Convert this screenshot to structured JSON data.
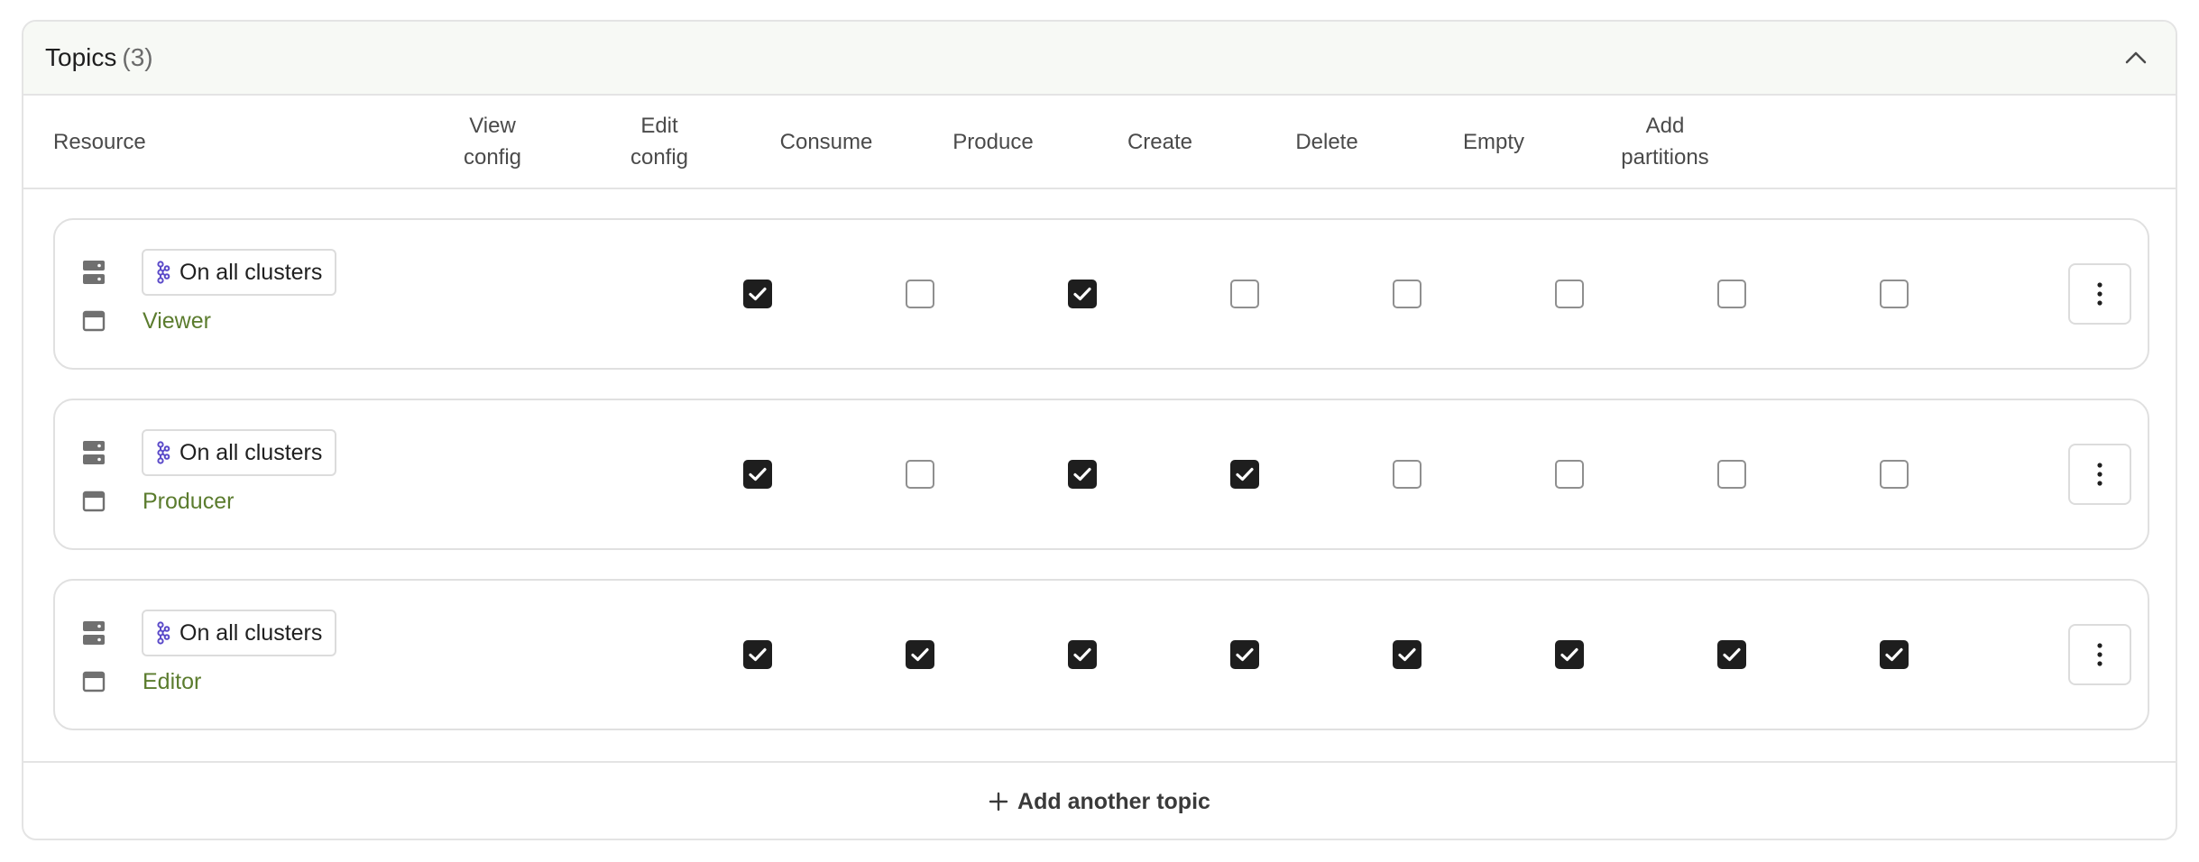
{
  "section": {
    "title": "Topics",
    "count": "(3)"
  },
  "columns": {
    "resource": "Resource",
    "view_config": [
      "View",
      "config"
    ],
    "edit_config": [
      "Edit",
      "config"
    ],
    "consume": "Consume",
    "produce": "Produce",
    "create": "Create",
    "delete": "Delete",
    "empty": "Empty",
    "add_partitions": [
      "Add",
      "partitions"
    ]
  },
  "rows": [
    {
      "cluster": "On all clusters",
      "name": "Viewer",
      "perms": [
        true,
        false,
        true,
        false,
        false,
        false,
        false,
        false
      ]
    },
    {
      "cluster": "On all clusters",
      "name": "Producer",
      "perms": [
        true,
        false,
        true,
        true,
        false,
        false,
        false,
        false
      ]
    },
    {
      "cluster": "On all clusters",
      "name": "Editor",
      "perms": [
        true,
        true,
        true,
        true,
        true,
        true,
        true,
        true
      ]
    }
  ],
  "footer": {
    "add_label": "Add another topic"
  },
  "icons": {
    "collapse": "chevron-up-icon",
    "cluster_group": "server-stack-icon",
    "topic": "topic-window-icon",
    "cluster_chip": "kafka-cluster-icon",
    "more": "more-vertical-icon",
    "add": "plus-icon",
    "checked": "check-icon"
  },
  "colors": {
    "accent_green": "#5b7c2e",
    "chip_icon": "#5a49c9",
    "checkbox_on": "#1e1e1e",
    "header_bg": "#f7f9f5"
  }
}
